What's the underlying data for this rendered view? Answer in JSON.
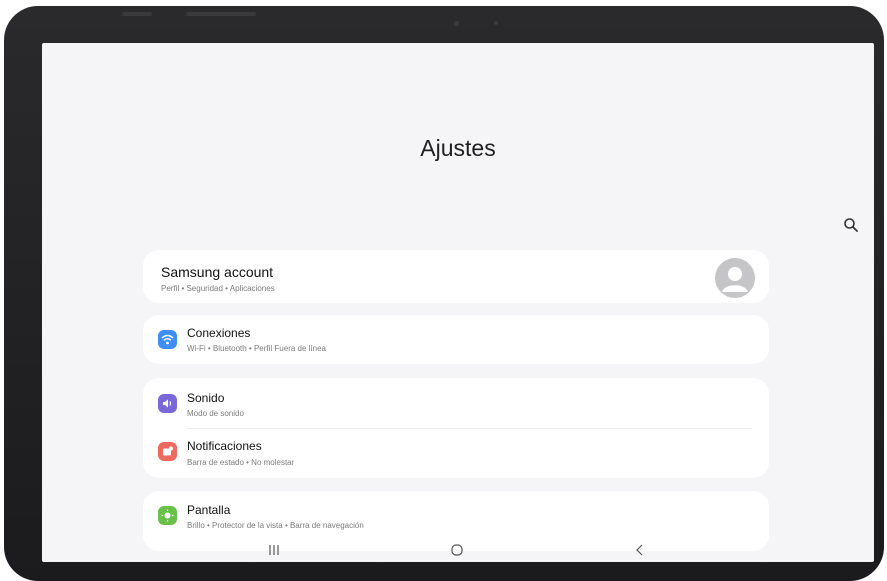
{
  "settings": {
    "title": "Ajustes",
    "search_icon": "search-icon"
  },
  "account": {
    "title": "Samsung account",
    "subtitle": "Perfil • Seguridad • Aplicaciones",
    "avatar_icon": "person-avatar-icon"
  },
  "items": [
    {
      "title": "Conexiones",
      "subtitle": "Wi-Fi • Bluetooth • Perfil Fuera de línea",
      "icon": "wifi-icon",
      "color": "#3f8ef5"
    },
    {
      "title": "Sonido",
      "subtitle": "Modo de sonido",
      "icon": "sound-icon",
      "color": "#7a67d8"
    },
    {
      "title": "Notificaciones",
      "subtitle": "Barra de estado • No molestar",
      "icon": "notification-icon",
      "color": "#ec6b5e"
    },
    {
      "title": "Pantalla",
      "subtitle": "Brillo • Protector de la vista • Barra de navegación",
      "icon": "display-icon",
      "color": "#69c14a"
    }
  ],
  "navbar": {
    "recents_icon": "recents-icon",
    "home_icon": "home-icon",
    "back_icon": "back-icon"
  },
  "colors": {
    "background": "#f5f5f7",
    "card": "#ffffff",
    "bezel": "#1f1f21"
  }
}
